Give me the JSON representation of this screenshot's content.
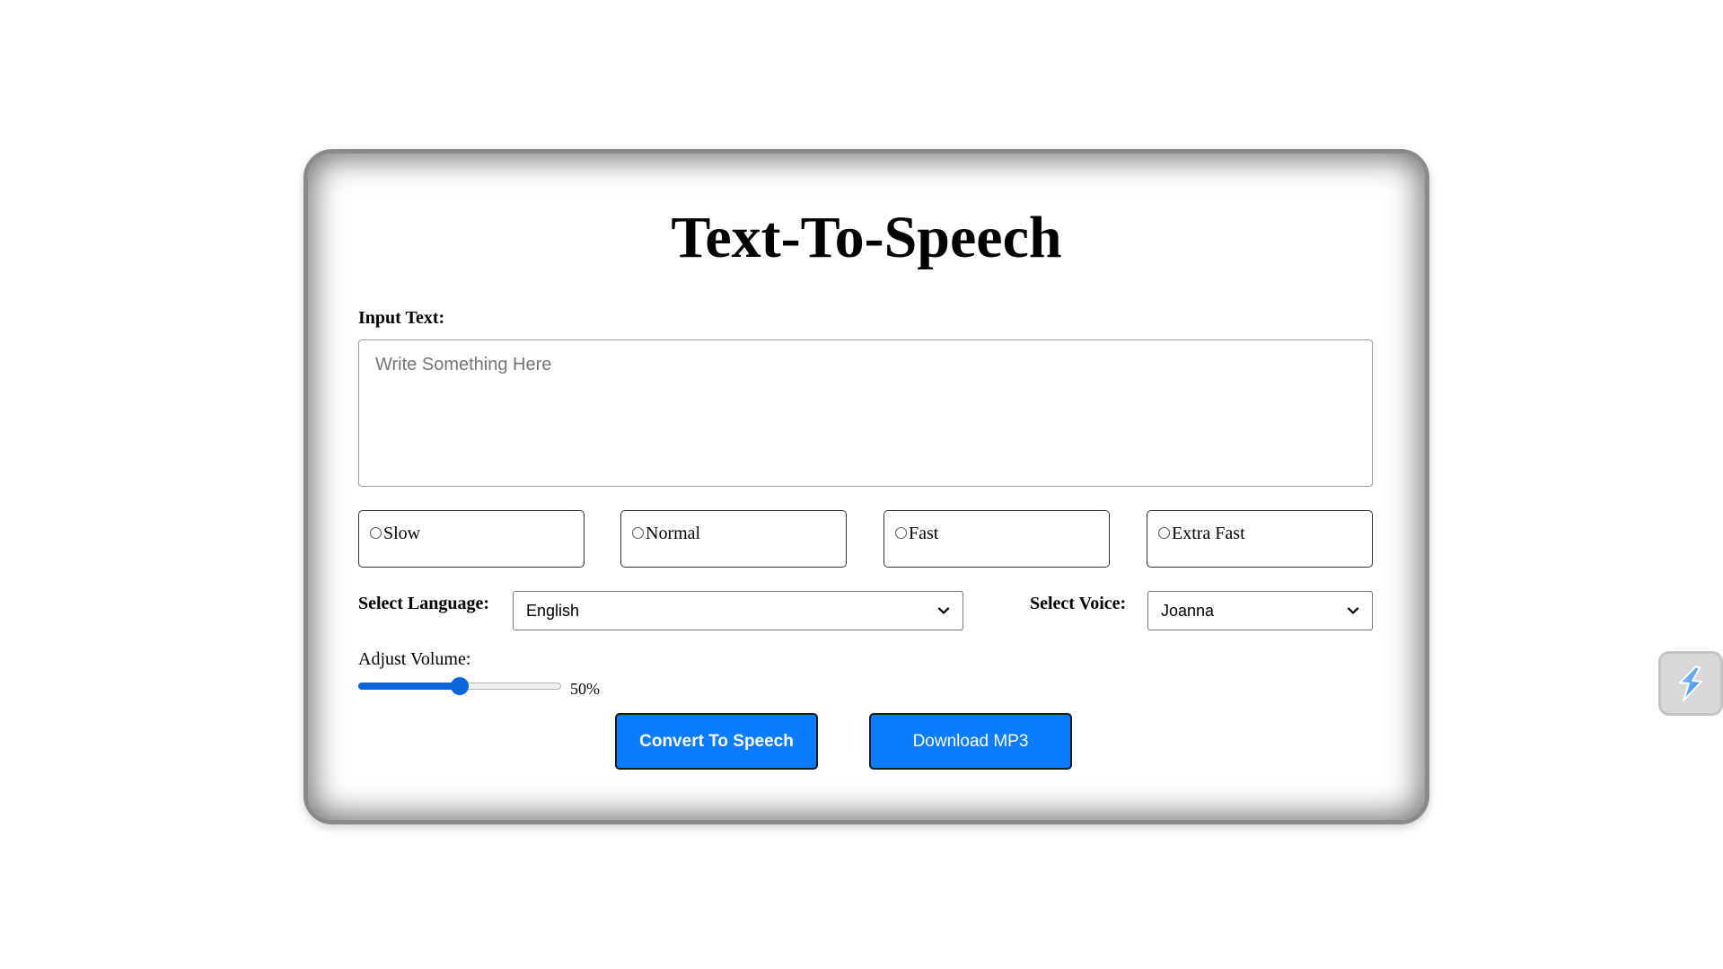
{
  "title": "Text-To-Speech",
  "input": {
    "label": "Input Text:",
    "placeholder": "Write Something Here",
    "value": ""
  },
  "speed_options": [
    {
      "label": "Slow",
      "selected": false
    },
    {
      "label": "Normal",
      "selected": false
    },
    {
      "label": "Fast",
      "selected": false
    },
    {
      "label": "Extra Fast",
      "selected": false
    }
  ],
  "language": {
    "label": "Select Language:",
    "selected": "English"
  },
  "voice": {
    "label": "Select Voice:",
    "selected": "Joanna"
  },
  "volume": {
    "label": "Adjust Volume:",
    "value_text": "50%",
    "level": 0.5
  },
  "buttons": {
    "convert": "Convert To Speech",
    "download": "Download MP3"
  },
  "colors": {
    "button_bg": "#0a7cff",
    "slider_accent": "#0a66d8"
  },
  "icons": {
    "floating_widget": "lightning-bolt-icon"
  }
}
